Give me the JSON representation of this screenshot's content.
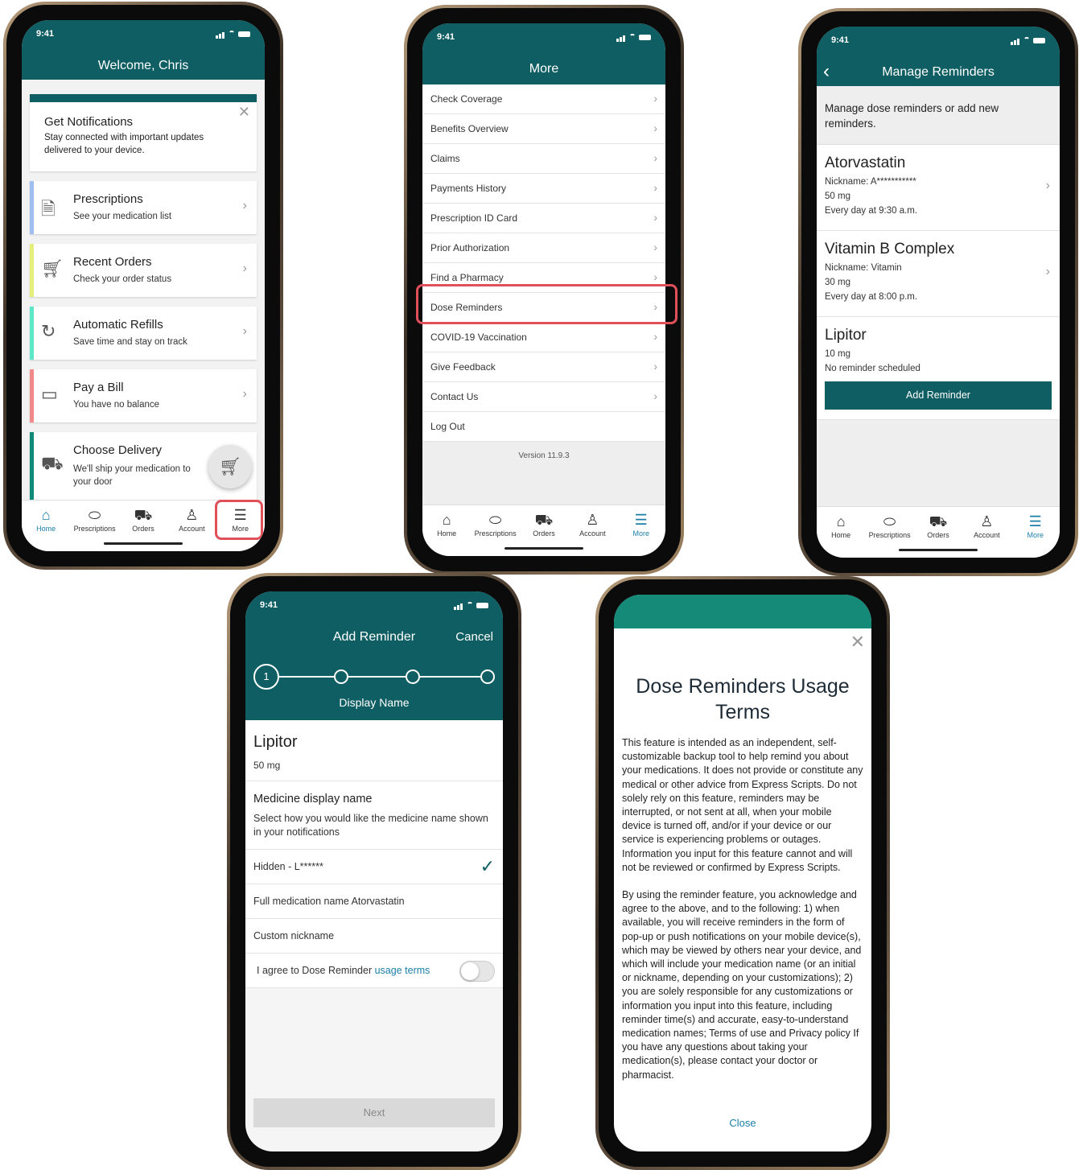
{
  "status_time": "9:41",
  "tabs": [
    "Home",
    "Prescriptions",
    "Orders",
    "Account",
    "More"
  ],
  "screen1": {
    "title": "Welcome, Chris",
    "notif_title": "Get Notifications",
    "notif_body": "Stay connected with important updates delivered to your device.",
    "cards": [
      {
        "title": "Prescriptions",
        "subtitle": "See your medication list",
        "accent": "#9fbff0"
      },
      {
        "title": "Recent Orders",
        "subtitle": "Check your order status",
        "accent": "#e4ef7a"
      },
      {
        "title": "Automatic Refills",
        "subtitle": "Save time and stay on track",
        "accent": "#5ee6c8"
      },
      {
        "title": "Pay a Bill",
        "subtitle": "You have no balance",
        "accent": "#f08a8a"
      },
      {
        "title": "Choose Delivery",
        "subtitle": "We'll ship your medication to your door",
        "accent": "#0f8a78"
      }
    ]
  },
  "screen2": {
    "title": "More",
    "items": [
      "Check Coverage",
      "Benefits Overview",
      "Claims",
      "Payments History",
      "Prescription ID Card",
      "Prior Authorization",
      "Find a Pharmacy",
      "Dose Reminders",
      "COVID-19 Vaccination",
      "Give Feedback",
      "Contact Us",
      "Log Out"
    ],
    "version": "Version 11.9.3"
  },
  "screen3": {
    "title": "Manage Reminders",
    "intro": "Manage dose reminders or add new reminders.",
    "reminders": [
      {
        "name": "Atorvastatin",
        "nickname": "Nickname: A***********",
        "dose": "50 mg",
        "schedule": "Every day at 9:30 a.m."
      },
      {
        "name": "Vitamin B Complex",
        "nickname": "Nickname: Vitamin",
        "dose": "30 mg",
        "schedule": "Every day at 8:00 p.m."
      },
      {
        "name": "Lipitor",
        "dose": "10 mg",
        "schedule": "No reminder scheduled"
      }
    ],
    "add_button": "Add Reminder"
  },
  "screen4": {
    "title": "Add Reminder",
    "cancel": "Cancel",
    "step_number": "1",
    "step_label": "Display Name",
    "drug_name": "Lipitor",
    "drug_dose": "50 mg",
    "section_title": "Medicine display name",
    "section_desc": "Select how you would like the medicine name shown in your notifications",
    "options": [
      "Hidden - L******",
      "Full medication name Atorvastatin",
      "Custom nickname"
    ],
    "agree_text": "I agree to Dose Reminder ",
    "agree_link": "usage terms",
    "next_button": "Next"
  },
  "screen5": {
    "title": "Dose Reminders Usage Terms",
    "para1": "This feature is intended as an independent, self-customizable backup tool to help remind you about your medications. It does not provide or constitute any medical or other advice from Express Scripts.   Do not solely rely on this feature, reminders may be interrupted, or not sent at all, when your mobile device is turned off, and/or if your device or our service is experiencing problems or outages. Information you input for this feature cannot and will not be reviewed or confirmed by Express Scripts.",
    "para2": "By using the reminder feature, you acknowledge and agree to the above, and to the following: 1) when available, you will receive reminders in the form of pop-up or push notifications on your mobile device(s), which may be viewed by others near your device, and which will include your medication name (or an initial or nickname, depending on your customizations); 2) you are solely responsible for any customizations or information you input into this feature, including reminder time(s) and accurate, easy-to-understand medication names; Terms of use and Privacy policy If you have any questions about taking your medication(s), please contact your doctor or pharmacist.",
    "close": "Close"
  }
}
